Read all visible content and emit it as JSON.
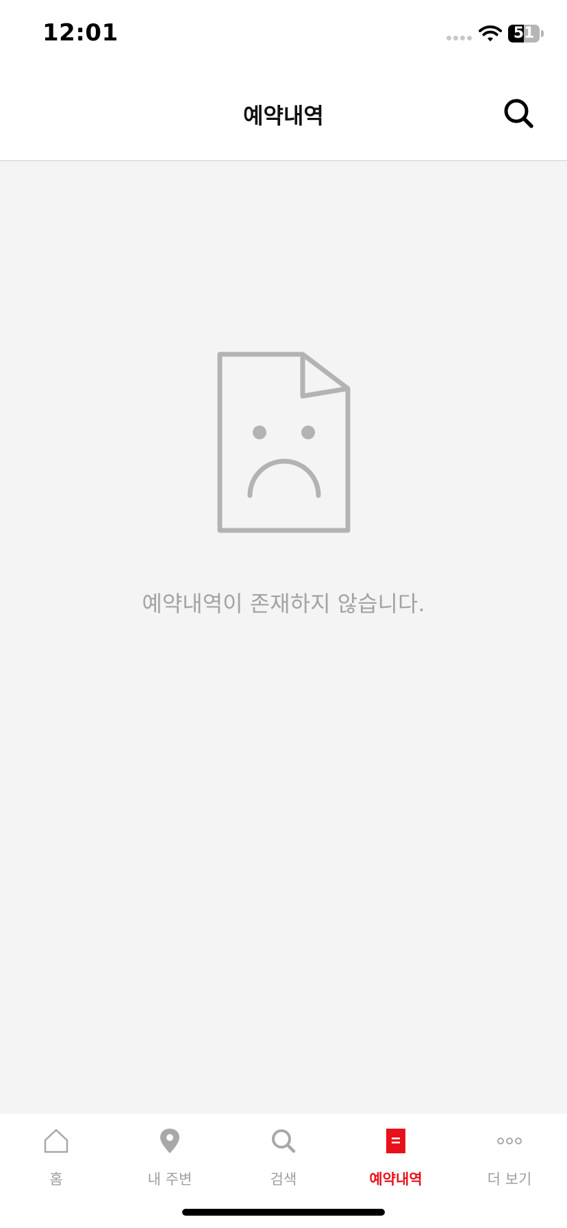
{
  "status_bar": {
    "time": "12:01",
    "battery_percent": "51",
    "battery_level": 0.51
  },
  "header": {
    "title": "예약내역",
    "search_icon": "search-icon"
  },
  "empty_state": {
    "icon": "sad-document-icon",
    "message": "예약내역이 존재하지 않습니다."
  },
  "tab_bar": {
    "active_color": "#e8111b",
    "inactive_color": "#9e9e9e",
    "tabs": [
      {
        "label": "홈",
        "icon": "home-icon",
        "active": false
      },
      {
        "label": "내 주변",
        "icon": "location-pin-icon",
        "active": false
      },
      {
        "label": "검색",
        "icon": "search-icon",
        "active": false
      },
      {
        "label": "예약내역",
        "icon": "reservation-list-icon",
        "active": true
      },
      {
        "label": "더 보기",
        "icon": "more-icon",
        "active": false
      }
    ]
  }
}
